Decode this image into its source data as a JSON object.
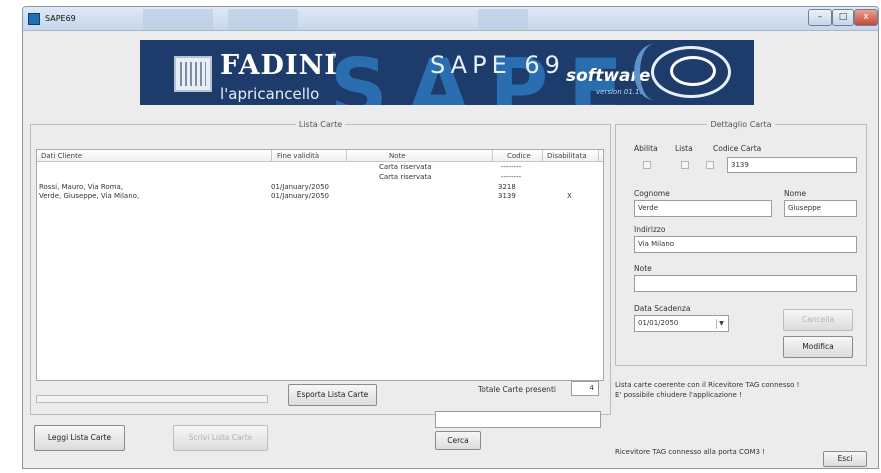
{
  "window": {
    "title": "SAPE69",
    "buttons": {
      "minimize": "–",
      "maximize": "□",
      "close": "x"
    }
  },
  "banner": {
    "brand": "FADINI",
    "brand_mark": "®",
    "tagline": "l'apricancello",
    "product": "SAPE 69",
    "background_letters": "SAPE",
    "software": "software",
    "version": "version 01.11"
  },
  "list": {
    "legend": "Lista Carte",
    "columns": [
      "Dati Cliente",
      "Fine validità",
      "Note",
      "Codice",
      "Disabilitata"
    ],
    "rows": [
      {
        "cliente": "",
        "fine": "",
        "note": "Carta riservata",
        "codice": "--------",
        "disabilitata": ""
      },
      {
        "cliente": "",
        "fine": "",
        "note": "Carta riservata",
        "codice": "--------",
        "disabilitata": ""
      },
      {
        "cliente": "Rossi, Mauro, Via Roma,",
        "fine": "01/January/2050",
        "note": "",
        "codice": "3218",
        "disabilitata": ""
      },
      {
        "cliente": "Verde, Giuseppe, Via Milano,",
        "fine": "01/January/2050",
        "note": "",
        "codice": "3139",
        "disabilitata": "X"
      }
    ],
    "export_button": "Esporta Lista Carte",
    "total_label": "Totale Carte presenti",
    "total_value": "4"
  },
  "bottom": {
    "read_button": "Leggi Lista Carte",
    "write_button": "Scrivi Lista Carte",
    "search_value": "",
    "search_button": "Cerca"
  },
  "detail": {
    "legend": "Dettaglio Carta",
    "abilita_label": "Abilita",
    "lista_label": "Lista",
    "codice_label": "Codice Carta",
    "codice_value": "3139",
    "cognome_label": "Cognome",
    "cognome_value": "Verde",
    "nome_label": "Nome",
    "nome_value": "Giuseppe",
    "indirizzo_label": "Indirizzo",
    "indirizzo_value": "Via Milano",
    "note_label": "Note",
    "note_value": "",
    "scadenza_label": "Data Scadenza",
    "scadenza_value": "01/01/2050",
    "cancella_button": "Cancella",
    "modifica_button": "Modifica"
  },
  "status": {
    "line1": "Lista carte coerente con il Ricevitore TAG connesso !",
    "line2": "E' possibile chiudere l'applicazione !",
    "port": "Ricevitore TAG connesso alla porta COM3 !",
    "exit_button": "Esci"
  }
}
